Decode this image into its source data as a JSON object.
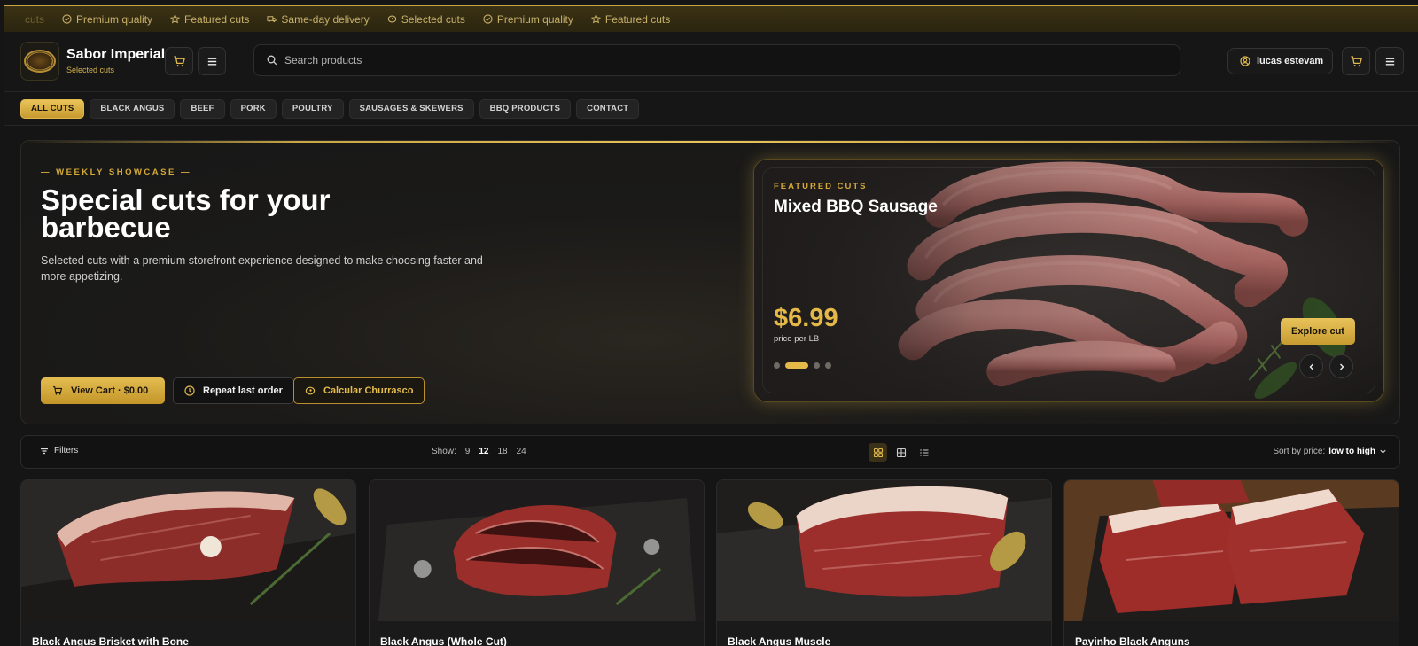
{
  "ticker": [
    "cuts",
    "Premium quality",
    "Featured cuts",
    "Same-day delivery",
    "Selected cuts",
    "Premium quality",
    "Featured cuts"
  ],
  "brand": {
    "name": "Sabor Imperial",
    "tagline": "Selected cuts"
  },
  "search": {
    "placeholder": "Search products"
  },
  "user": {
    "name": "lucas estevam"
  },
  "categories": [
    "ALL CUTS",
    "BLACK ANGUS",
    "BEEF",
    "PORK",
    "POULTRY",
    "SAUSAGES & SKEWERS",
    "BBQ PRODUCTS",
    "CONTACT"
  ],
  "hero": {
    "eyebrow": "— WEEKLY SHOWCASE —",
    "title": "Special cuts for your barbecue",
    "description": "Selected cuts with a premium storefront experience designed to make choosing faster and more appetizing.",
    "buttons": {
      "cart": "View Cart · $0.00",
      "repeat": "Repeat last order",
      "churrasco": "Calcular Churrasco"
    }
  },
  "featured": {
    "eyebrow": "FEATURED CUTS",
    "title": "Mixed BBQ Sausage",
    "price": "$6.99",
    "unit": "price per LB",
    "cta": "Explore cut",
    "slides": 4,
    "active_slide": 2
  },
  "toolbar": {
    "filters": "Filters",
    "show_label": "Show:",
    "show_options": [
      "9",
      "12",
      "18",
      "24"
    ],
    "show_selected": "12",
    "sort_label": "Sort by price:",
    "sort_value": "low to high"
  },
  "products": [
    {
      "name": "Black Angus Brisket with Bone"
    },
    {
      "name": "Black Angus (Whole Cut)"
    },
    {
      "name": "Black Angus Muscle"
    },
    {
      "name": "Payinho Black Anguns"
    }
  ],
  "colors": {
    "accent": "#d4a937",
    "background": "#151515",
    "panel": "#1a1a1a"
  }
}
